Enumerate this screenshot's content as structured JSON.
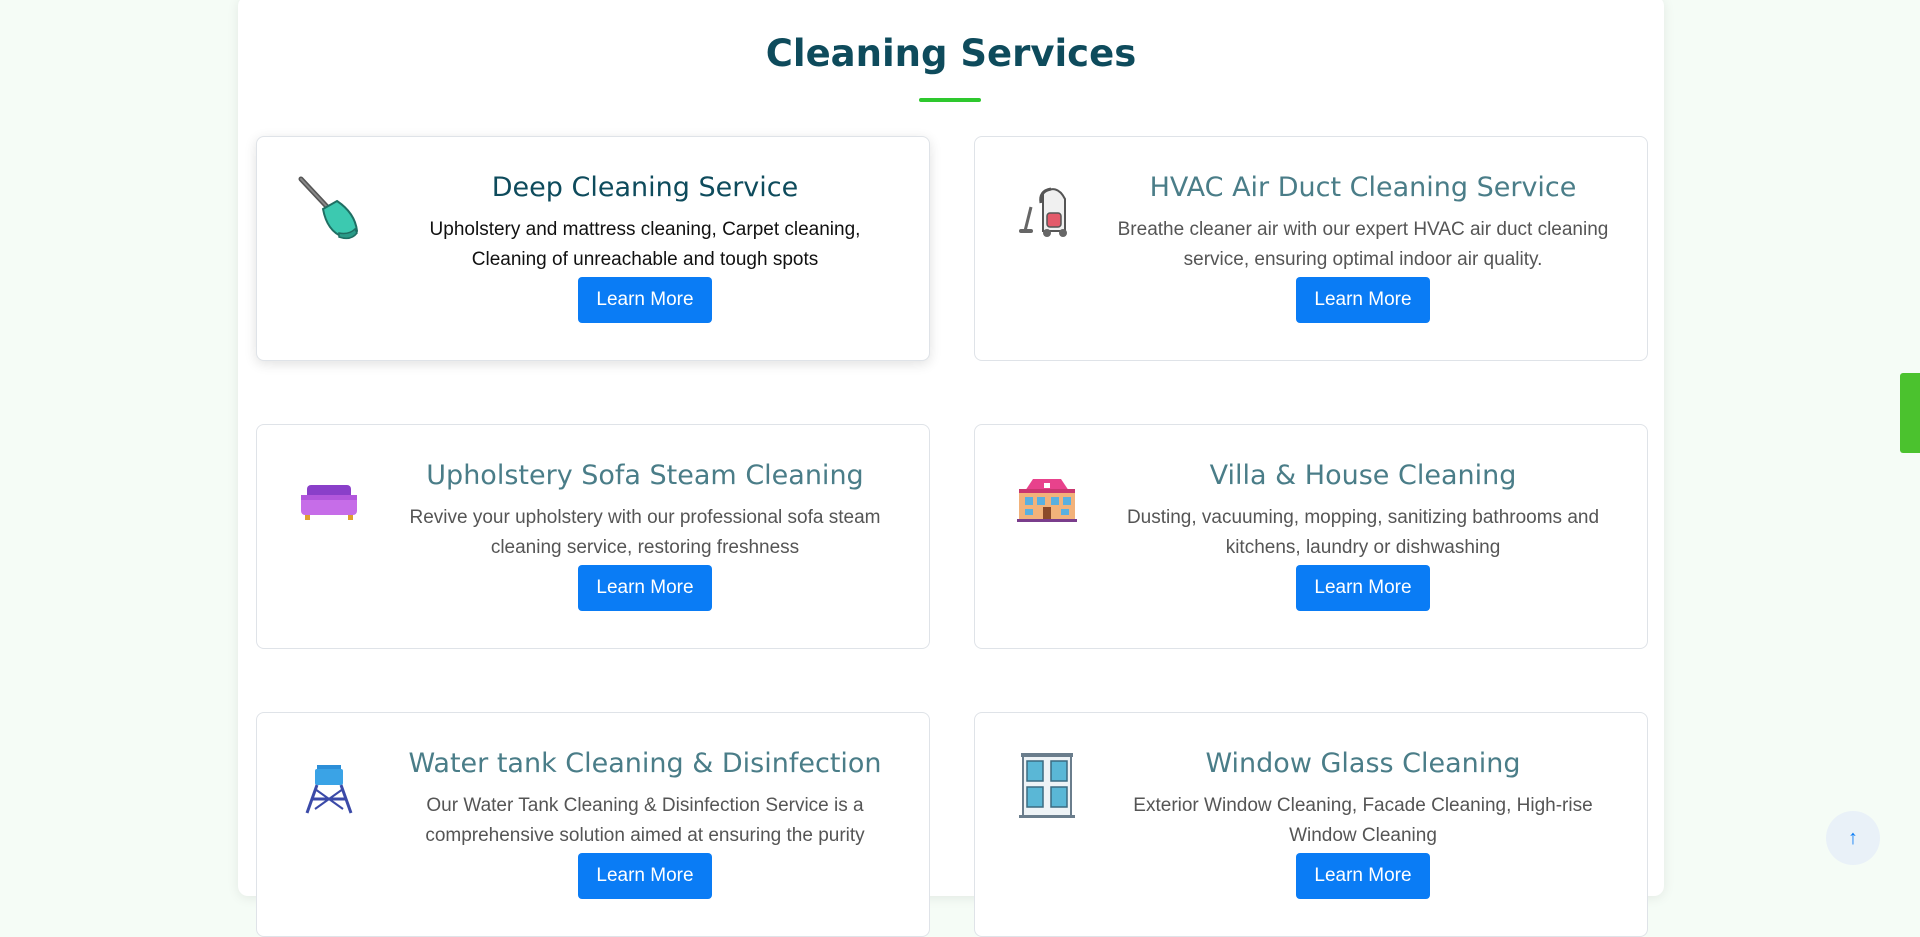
{
  "section": {
    "title": "Cleaning Services",
    "accent_color": "#2ec82e",
    "title_color": "#0e4b5c"
  },
  "services": [
    {
      "title": "Deep Cleaning Service",
      "description_line1": "Upholstery and mattress cleaning, Carpet cleaning,",
      "description_line2": "Cleaning of unreachable and tough spots",
      "button_label": "Learn More",
      "icon": "plunger-icon"
    },
    {
      "title": "HVAC Air Duct Cleaning Service",
      "description_line1": "Breathe cleaner air with our expert HVAC air duct cleaning",
      "description_line2": "service, ensuring optimal indoor air quality.",
      "button_label": "Learn More",
      "icon": "vacuum-cleaner-icon"
    },
    {
      "title": "Upholstery Sofa Steam Cleaning",
      "description_line1": "Revive your upholstery with our professional sofa steam",
      "description_line2": "cleaning service, restoring freshness",
      "button_label": "Learn More",
      "icon": "sofa-icon"
    },
    {
      "title": "Villa & House Cleaning",
      "description_line1": "Dusting, vacuuming, mopping, sanitizing bathrooms and",
      "description_line2": "kitchens, laundry or dishwashing",
      "button_label": "Learn More",
      "icon": "house-icon"
    },
    {
      "title": "Water tank Cleaning & Disinfection",
      "description_line1": "Our Water Tank Cleaning & Disinfection Service is a",
      "description_line2": "comprehensive solution aimed at ensuring the purity",
      "button_label": "Learn More",
      "icon": "water-tower-icon"
    },
    {
      "title": "Window Glass Cleaning",
      "description_line1": "Exterior Window Cleaning, Facade Cleaning, High-rise",
      "description_line2": "Window Cleaning",
      "button_label": "Learn More",
      "icon": "building-windows-icon"
    }
  ],
  "button_color": "#0a7cf5",
  "back_to_top": {
    "icon": "arrow-up-icon",
    "glyph": "↑"
  }
}
